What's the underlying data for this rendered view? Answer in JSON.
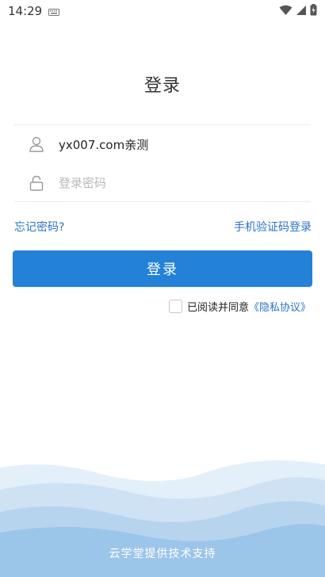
{
  "status_bar": {
    "time": "14:29",
    "icons": [
      "keyboard-icon",
      "wifi-icon",
      "signal-icon",
      "battery-icon"
    ]
  },
  "page": {
    "title": "登录"
  },
  "form": {
    "username": {
      "value": "yx007.com亲测",
      "icon": "user-icon"
    },
    "password": {
      "value": "",
      "placeholder": "登录密码",
      "icon": "lock-icon"
    },
    "forgot_password": "忘记密码?",
    "sms_login": "手机验证码登录",
    "login_button": "登录"
  },
  "agreement": {
    "text": "已阅读并同意",
    "link": "《隐私协议》",
    "checked": false
  },
  "footer": {
    "text": "云学堂提供技术支持"
  },
  "colors": {
    "accent": "#2381d8",
    "link": "#2a73c8",
    "wave_light": "#d9e9f7",
    "wave_mid": "#b4d2ef",
    "wave_dark": "#8fbde8"
  }
}
